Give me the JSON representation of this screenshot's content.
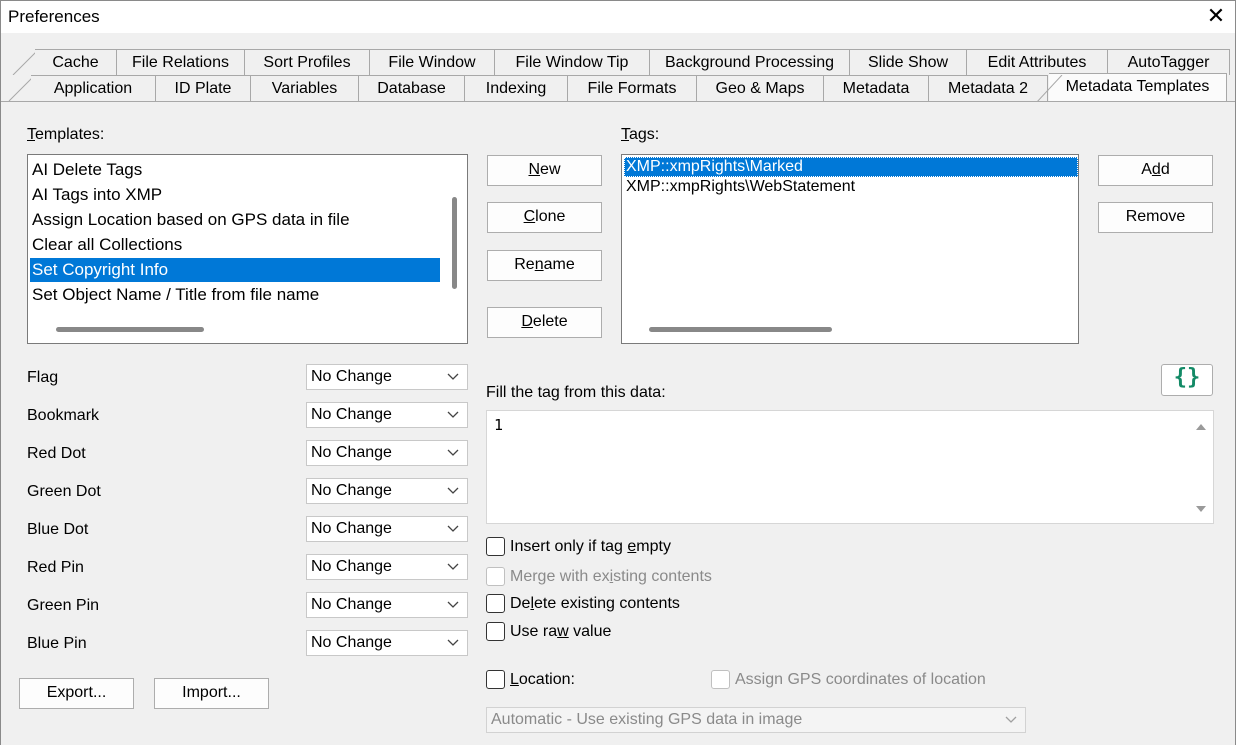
{
  "window": {
    "title": "Preferences"
  },
  "tabs_row1": [
    "Cache",
    "File Relations",
    "Sort Profiles",
    "File Window",
    "File Window Tip",
    "Background Processing",
    "Slide Show",
    "Edit Attributes",
    "AutoTagger"
  ],
  "tabs_row2": [
    "Application",
    "ID Plate",
    "Variables",
    "Database",
    "Indexing",
    "File Formats",
    "Geo & Maps",
    "Metadata",
    "Metadata 2",
    "Metadata Templates"
  ],
  "active_tab": "Metadata Templates",
  "templates": {
    "label_prefix": "T",
    "label_rest": "emplates:",
    "items": [
      "AI Delete Tags",
      "AI Tags into XMP",
      "Assign Location based on GPS data in file",
      "Clear all Collections",
      "Set Copyright Info",
      "Set Object Name / Title from file name"
    ],
    "selected": "Set Copyright Info"
  },
  "template_buttons": {
    "new": {
      "pre": "",
      "ul": "N",
      "post": "ew"
    },
    "clone": {
      "pre": "",
      "ul": "C",
      "post": "lone"
    },
    "rename": {
      "pre": "Re",
      "ul": "n",
      "post": "ame"
    },
    "delete": {
      "pre": "",
      "ul": "D",
      "post": "elete"
    }
  },
  "tags": {
    "label_prefix": "T",
    "label_rest": "ags:",
    "items": [
      "XMP::xmpRights\\Marked",
      "XMP::xmpRights\\WebStatement"
    ],
    "selected": "XMP::xmpRights\\Marked"
  },
  "tag_buttons": {
    "add": {
      "pre": "A",
      "ul": "d",
      "post": "d"
    },
    "remove": "Remove"
  },
  "attributes": [
    {
      "label": "Flag",
      "value": "No Change"
    },
    {
      "label": "Bookmark",
      "value": "No Change"
    },
    {
      "label": "Red Dot",
      "value": "No Change"
    },
    {
      "label": "Green Dot",
      "value": "No Change"
    },
    {
      "label": "Blue Dot",
      "value": "No Change"
    },
    {
      "label": "Red Pin",
      "value": "No Change"
    },
    {
      "label": "Green Pin",
      "value": "No Change"
    },
    {
      "label": "Blue Pin",
      "value": "No Change"
    }
  ],
  "fill": {
    "label": "Fill the tag from this data:",
    "value": "1",
    "braces_button": "{}"
  },
  "options": {
    "insert_only": {
      "pre": "Insert only if tag ",
      "ul": "e",
      "post": "mpty",
      "checked": false,
      "enabled": true
    },
    "merge": {
      "pre": "Merge with ex",
      "ul": "i",
      "post": "sting contents",
      "checked": false,
      "enabled": false
    },
    "delete_existing": {
      "pre": "De",
      "ul": "l",
      "post": "ete existing contents",
      "checked": false,
      "enabled": true
    },
    "use_raw": {
      "pre": "Use ra",
      "ul": "w",
      "post": " value",
      "checked": false,
      "enabled": true
    }
  },
  "location": {
    "label_pre": "",
    "label_ul": "L",
    "label_post": "ocation:",
    "assign_gps": "Assign GPS coordinates of location",
    "mode": "Automatic -  Use existing GPS data in image"
  },
  "bottom_buttons": {
    "export": "Export...",
    "import": "Import..."
  },
  "colors": {
    "selection": "#0078d7",
    "braces": "#138a66"
  }
}
